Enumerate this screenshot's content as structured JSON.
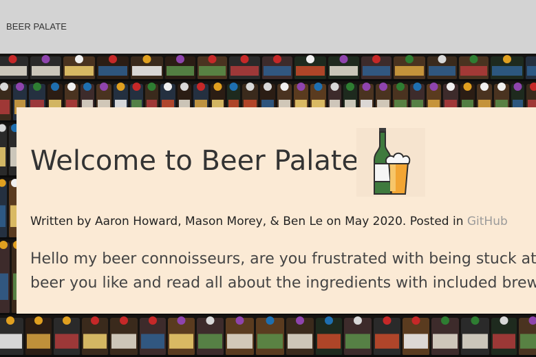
{
  "navbar": {
    "brand": "BEER PALATE"
  },
  "hero": {
    "image": "beer-bottles-shelf-background"
  },
  "card": {
    "title": "Welcome to Beer Palate!!",
    "logo": "beer-bottle-and-glass-icon",
    "byline_prefix": "Written by Aaron Howard, Mason Morey, & Ben Le on May 2020. Posted in ",
    "byline_link": "GitHub",
    "intro_line1": "Hello my beer connoisseurs, are you frustrated with being stuck at ho",
    "intro_line2": "beer you like and read all about the ingredients with included brewing"
  },
  "colors": {
    "navbar_bg": "#d3d3d3",
    "card_bg": "#fbead5",
    "link": "#9a9a9a"
  }
}
